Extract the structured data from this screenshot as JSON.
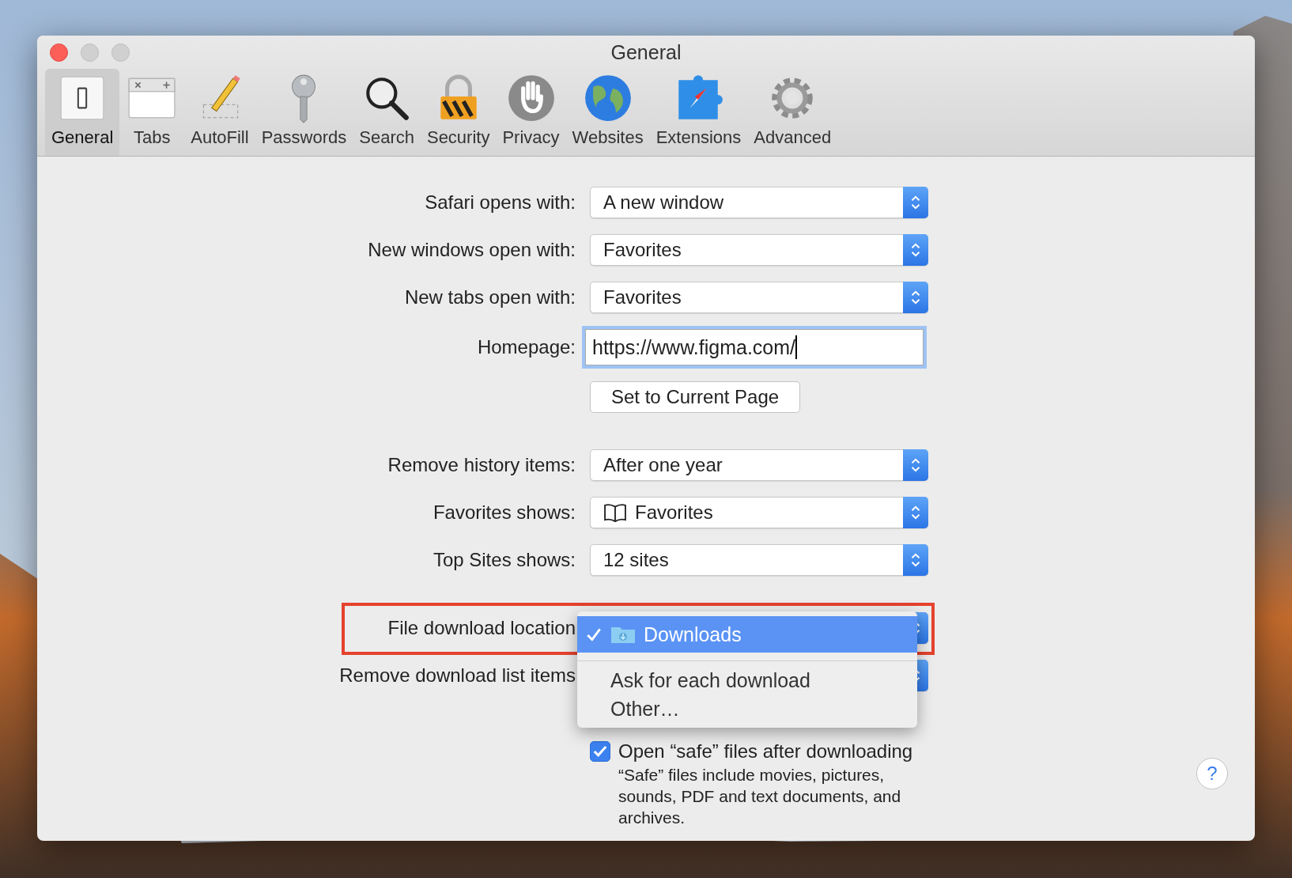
{
  "window": {
    "title": "General"
  },
  "toolbar": [
    {
      "kind": "general",
      "label": "General",
      "selected": true
    },
    {
      "kind": "tabs",
      "label": "Tabs",
      "selected": false
    },
    {
      "kind": "autofill",
      "label": "AutoFill",
      "selected": false
    },
    {
      "kind": "passwords",
      "label": "Passwords",
      "selected": false
    },
    {
      "kind": "search",
      "label": "Search",
      "selected": false
    },
    {
      "kind": "security",
      "label": "Security",
      "selected": false
    },
    {
      "kind": "privacy",
      "label": "Privacy",
      "selected": false
    },
    {
      "kind": "websites",
      "label": "Websites",
      "selected": false
    },
    {
      "kind": "extensions",
      "label": "Extensions",
      "selected": false
    },
    {
      "kind": "advanced",
      "label": "Advanced",
      "selected": false
    }
  ],
  "groups": [
    [
      {
        "kind": "popup",
        "label": "Safari opens with:",
        "value": "A new window"
      },
      {
        "kind": "popup",
        "label": "New windows open with:",
        "value": "Favorites"
      },
      {
        "kind": "popup",
        "label": "New tabs open with:",
        "value": "Favorites"
      },
      {
        "kind": "field",
        "label": "Homepage:",
        "value": "https://www.figma.com/"
      },
      {
        "kind": "button",
        "label": "Set to Current Page"
      }
    ],
    [
      {
        "kind": "popup",
        "label": "Remove history items:",
        "value": "After one year"
      },
      {
        "kind": "bookpopup",
        "label": "Favorites shows:",
        "value": "Favorites"
      },
      {
        "kind": "popup",
        "label": "Top Sites shows:",
        "value": "12 sites"
      }
    ],
    [
      {
        "kind": "popup",
        "label": "File download location",
        "highlighted": true
      },
      {
        "kind": "popup",
        "label": "Remove download list items"
      }
    ]
  ],
  "menu": {
    "items": [
      {
        "kind": "folder",
        "label": "Downloads",
        "selected": true
      },
      {
        "kind": "text",
        "label": "Ask for each download",
        "selected": false
      },
      {
        "kind": "text",
        "label": "Other…",
        "selected": false
      }
    ]
  },
  "checkbox": {
    "label": "Open “safe” files after downloading",
    "checked": true
  },
  "note": "“Safe” files include movies, pictures, sounds, PDF and text documents, and archives.",
  "help": "?"
}
